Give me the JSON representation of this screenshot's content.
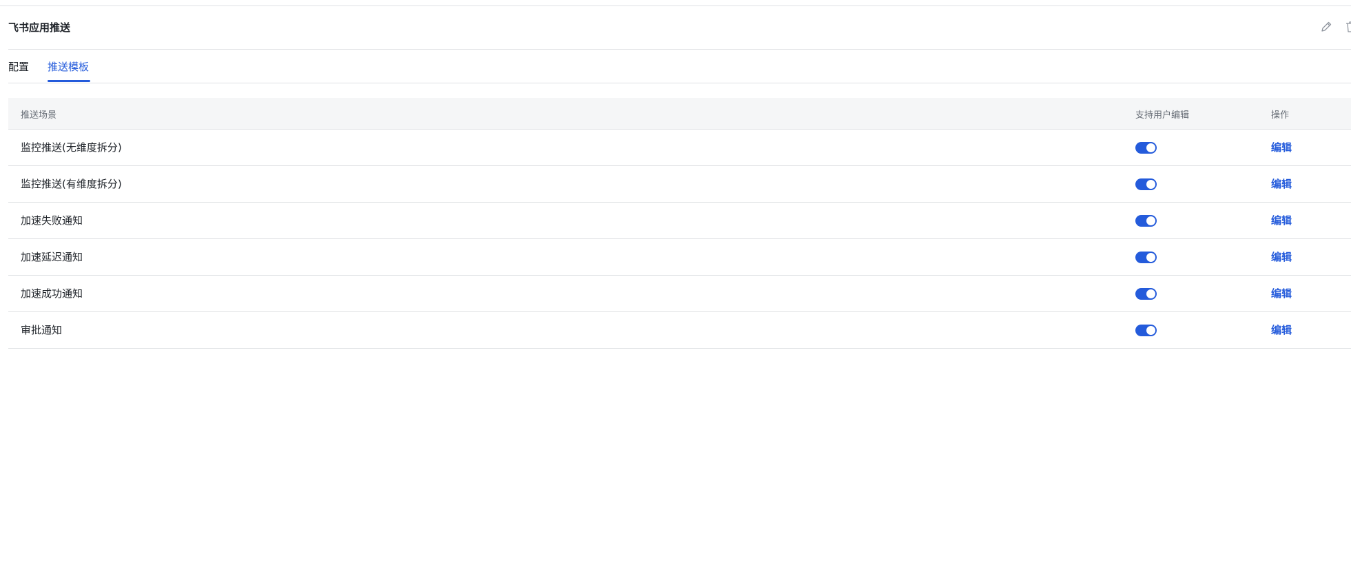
{
  "header": {
    "title": "飞书应用推送",
    "edit_icon": "pencil-icon",
    "delete_icon": "trash-icon"
  },
  "tabs": [
    {
      "label": "配置",
      "active": false
    },
    {
      "label": "推送模板",
      "active": true
    }
  ],
  "table": {
    "columns": [
      "推送场景",
      "支持用户编辑",
      "操作"
    ],
    "rows": [
      {
        "scene": "监控推送(无维度拆分)",
        "user_editable": true,
        "action": "编辑"
      },
      {
        "scene": "监控推送(有维度拆分)",
        "user_editable": true,
        "action": "编辑"
      },
      {
        "scene": "加速失败通知",
        "user_editable": true,
        "action": "编辑"
      },
      {
        "scene": "加速延迟通知",
        "user_editable": true,
        "action": "编辑"
      },
      {
        "scene": "加速成功通知",
        "user_editable": true,
        "action": "编辑"
      },
      {
        "scene": "审批通知",
        "user_editable": true,
        "action": "编辑"
      }
    ]
  },
  "colors": {
    "accent": "#245bdb",
    "header_bg": "#f5f6f7",
    "border": "#dee0e3"
  }
}
